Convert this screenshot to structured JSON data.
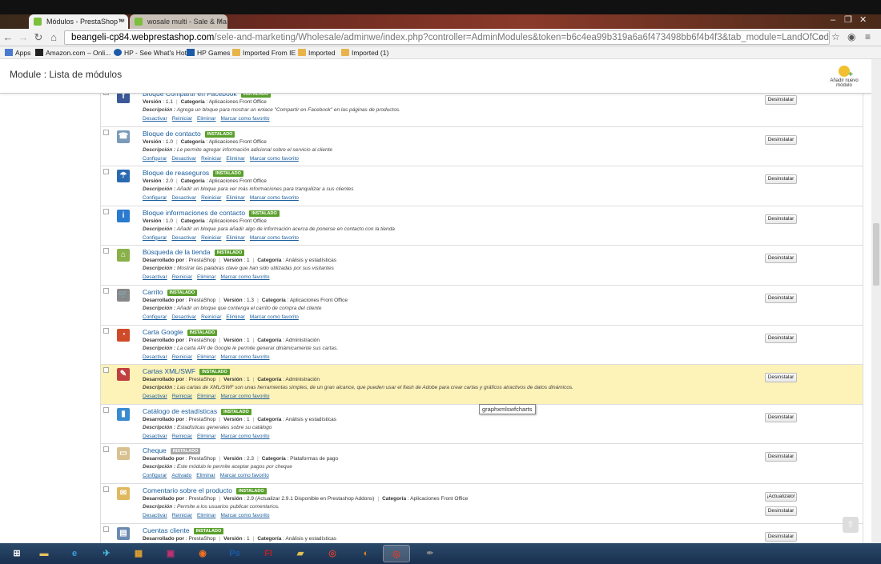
{
  "browser": {
    "tabs": [
      {
        "title": "Módulos - PrestaShop™",
        "active": true
      },
      {
        "title": "wosale multi - Sale & Ma",
        "active": false
      }
    ],
    "url_host": "beangeli-cp84.webprestashop.com",
    "url_rest": "/sele-and-marketing/Wholesale/adminwe/index.php?controller=AdminModules&token=b6c4ea99b319a6a6f473498bb6f4b4f3&tab_module=LandOfCoder&module_na",
    "bookmarks": [
      {
        "label": "Apps",
        "icon": "apps-grid-icon"
      },
      {
        "label": "Amazon.com – Onli...",
        "icon": "amazon-icon"
      },
      {
        "label": "HP - See What's Hot",
        "icon": "hp-icon"
      },
      {
        "label": "HP Games",
        "icon": "hp-games-icon"
      },
      {
        "label": "Imported From IE",
        "icon": "folder-icon"
      },
      {
        "label": "Imported",
        "icon": "folder-icon"
      },
      {
        "label": "Imported (1)",
        "icon": "folder-icon"
      }
    ]
  },
  "page": {
    "title": "Module : Lista de módulos",
    "add_module_label": "Añadir nuevo módulo",
    "tooltip": "graphxmlswfcharts"
  },
  "modules": [
    {
      "name": "Bloque Compartir en Facebook",
      "badge": "INSTALADO",
      "meta": [
        [
          "Versión",
          "1.1"
        ],
        [
          "Categoría",
          "Aplicaciones Front Office"
        ]
      ],
      "description": "Agrega un bloque para mostrar un enlace \"Compartir en Facebook\" en las páginas de productos.",
      "links": [
        "Desactivar",
        "Reiniciar",
        "Eliminar",
        "Marcar como favorito"
      ],
      "buttons": [
        "Desinstalar"
      ],
      "icon": "facebook-icon",
      "color": "#3b5998",
      "glyph": "f"
    },
    {
      "name": "Bloque de contacto",
      "badge": "INSTALADO",
      "meta": [
        [
          "Versión",
          "1.0"
        ],
        [
          "Categoría",
          "Aplicaciones Front Office"
        ]
      ],
      "description": "Le permite agregar información adicional sobre el servicio al cliente",
      "links": [
        "Configurar",
        "Desactivar",
        "Reiniciar",
        "Eliminar",
        "Marcar como favorito"
      ],
      "buttons": [
        "Desinstalar"
      ],
      "icon": "contact-card-icon",
      "color": "#7a9ab8",
      "glyph": "☎"
    },
    {
      "name": "Bloque de reaseguros",
      "badge": "INSTALADO",
      "meta": [
        [
          "Versión",
          "2.0"
        ],
        [
          "Categoría",
          "Aplicaciones Front Office"
        ]
      ],
      "description": "Añadir un bloque para ver más informaciones para tranquilizar a sus clientes",
      "links": [
        "Configurar",
        "Desactivar",
        "Reiniciar",
        "Eliminar",
        "Marcar como favorito"
      ],
      "buttons": [
        "Desinstalar"
      ],
      "icon": "umbrella-icon",
      "color": "#2a6ab0",
      "glyph": "☂"
    },
    {
      "name": "Bloque informaciones de contacto",
      "badge": "INSTALADO",
      "meta": [
        [
          "Versión",
          "1.0"
        ],
        [
          "Categoría",
          "Aplicaciones Front Office"
        ]
      ],
      "description": "Añadir un bloque para añadir algo de información acerca de ponerse en contacto con la tienda",
      "links": [
        "Configurar",
        "Desactivar",
        "Reiniciar",
        "Eliminar",
        "Marcar como favorito"
      ],
      "buttons": [
        "Desinstalar"
      ],
      "icon": "info-icon",
      "color": "#2a7ad0",
      "glyph": "i"
    },
    {
      "name": "Búsqueda de la tienda",
      "badge": "INSTALADO",
      "meta": [
        [
          "Desarrollado por",
          "PrestaShop"
        ],
        [
          "Versión",
          "1"
        ],
        [
          "Categoría",
          "Análisis y estadísticas"
        ]
      ],
      "description": "Mostrar las palabras clave que han sido utilizadas por sus visitantes",
      "links": [
        "Desactivar",
        "Reiniciar",
        "Eliminar",
        "Marcar como favorito"
      ],
      "buttons": [
        "Desinstalar"
      ],
      "icon": "store-search-icon",
      "color": "#8ab04a",
      "glyph": "⌂"
    },
    {
      "name": "Carrito",
      "badge": "INSTALADO",
      "meta": [
        [
          "Desarrollado por",
          "PrestaShop"
        ],
        [
          "Versión",
          "1.3"
        ],
        [
          "Categoría",
          "Aplicaciones Front Office"
        ]
      ],
      "description": "Añadir un bloque que contenga el carrito de compra del cliente",
      "links": [
        "Configurar",
        "Desactivar",
        "Reiniciar",
        "Eliminar",
        "Marcar como favorito"
      ],
      "buttons": [
        "Desinstalar"
      ],
      "icon": "cart-icon",
      "color": "#888888",
      "glyph": "🛒"
    },
    {
      "name": "Carta Google",
      "badge": "INSTALADO",
      "meta": [
        [
          "Desarrollado por",
          "PrestaShop"
        ],
        [
          "Versión",
          "1"
        ],
        [
          "Categoría",
          "Administración"
        ]
      ],
      "description": "La carta API de Google le permite generar dinámicamente sus cartas.",
      "links": [
        "Desactivar",
        "Reiniciar",
        "Eliminar",
        "Marcar como favorito"
      ],
      "buttons": [
        "Desinstalar"
      ],
      "icon": "pie-chart-icon",
      "color": "#d04a2a",
      "glyph": "◔"
    },
    {
      "name": "Cartas XML/SWF",
      "badge": "INSTALADO",
      "meta": [
        [
          "Desarrollado por",
          "PrestaShop"
        ],
        [
          "Versión",
          "1"
        ],
        [
          "Categoría",
          "Administración"
        ]
      ],
      "description": "Las cartas de XML/SWF son unas herramientas simples, de un gran alcance, que pueden usar el flash de Adobe para crear cartas y gráficos atractivos de datos dinámicos.",
      "links": [
        "Desactivar",
        "Reiniciar",
        "Eliminar",
        "Marcar como favorito"
      ],
      "buttons": [
        "Desinstalar"
      ],
      "icon": "document-pen-icon",
      "color": "#c04040",
      "glyph": "✎",
      "highlight": true
    },
    {
      "name": "Catálogo de estadísticas",
      "badge": "INSTALADO",
      "meta": [
        [
          "Desarrollado por",
          "PrestaShop"
        ],
        [
          "Versión",
          "1"
        ],
        [
          "Categoría",
          "Análisis y estadísticas"
        ]
      ],
      "description": "Estadísticas generales sobre su catálogo",
      "links": [
        "Desactivar",
        "Reiniciar",
        "Eliminar",
        "Marcar como favorito"
      ],
      "buttons": [
        "Desinstalar"
      ],
      "icon": "catalog-icon",
      "color": "#3a8ad0",
      "glyph": "▮"
    },
    {
      "name": "Cheque",
      "badge": "INSTALADO",
      "badge_grey": true,
      "meta": [
        [
          "Desarrollado por",
          "PrestaShop"
        ],
        [
          "Versión",
          "2.3"
        ],
        [
          "Categoría",
          "Plataformas de pago"
        ]
      ],
      "description": "Este módulo le permite aceptar pagos por cheque",
      "links": [
        "Configurar",
        "Activado",
        "Eliminar",
        "Marcar como favorito"
      ],
      "buttons": [
        "Desinstalar"
      ],
      "icon": "cheque-icon",
      "color": "#d8c090",
      "glyph": "▭"
    },
    {
      "name": "Comentario sobre el producto",
      "badge": "INSTALADO",
      "meta": [
        [
          "Desarrollado por",
          "PrestaShop"
        ],
        [
          "Versión",
          "2.9 (Actualizar 2.9.1 Disponible en Prestashop Addons)"
        ],
        [
          "Categoría",
          "Aplicaciones Front Office"
        ]
      ],
      "description": "Permite a los usuarios publicar comentarios.",
      "links": [
        "Desactivar",
        "Reiniciar",
        "Eliminar",
        "Marcar como favorito"
      ],
      "buttons": [
        "¡Actualizalo!",
        "Desinstalar"
      ],
      "icon": "comment-icon",
      "color": "#e0b860",
      "glyph": "✉"
    },
    {
      "name": "Cuentas cliente",
      "badge": "INSTALADO",
      "meta": [
        [
          "Desarrollado por",
          "PrestaShop"
        ],
        [
          "Versión",
          "1"
        ],
        [
          "Categoría",
          "Análisis y estadísticas"
        ]
      ],
      "description": "",
      "links": [],
      "buttons": [
        "Desinstalar"
      ],
      "icon": "customer-accounts-icon",
      "color": "#6a8ab0",
      "glyph": "▤"
    }
  ],
  "meta_labels": {
    "sep": "|",
    "desc_prefix": "Descripción :"
  },
  "taskbar": [
    {
      "name": "windows-start-icon",
      "glyph": "⊞",
      "color": "#ffffff"
    },
    {
      "name": "file-explorer-icon",
      "glyph": "▬",
      "color": "#e8c060"
    },
    {
      "name": "internet-explorer-icon",
      "glyph": "e",
      "color": "#3aa0e0"
    },
    {
      "name": "tool-icon",
      "glyph": "✈",
      "color": "#4ac0e0"
    },
    {
      "name": "paint-icon",
      "glyph": "▦",
      "color": "#e0a030"
    },
    {
      "name": "presentation-icon",
      "glyph": "▣",
      "color": "#c03070"
    },
    {
      "name": "media-icon",
      "glyph": "◉",
      "color": "#f07020"
    },
    {
      "name": "photoshop-icon",
      "glyph": "Ps",
      "color": "#1a5aa8"
    },
    {
      "name": "flash-icon",
      "glyph": "Fl",
      "color": "#c02020"
    },
    {
      "name": "folder-icon",
      "glyph": "▰",
      "color": "#e0c050"
    },
    {
      "name": "chrome-icon",
      "glyph": "◎",
      "color": "#d04030"
    },
    {
      "name": "firefox-icon",
      "glyph": "◐",
      "color": "#e08020"
    },
    {
      "name": "chrome-active-icon",
      "glyph": "◎",
      "color": "#d04030"
    },
    {
      "name": "pen-tool-icon",
      "glyph": "✒",
      "color": "#888888"
    }
  ]
}
